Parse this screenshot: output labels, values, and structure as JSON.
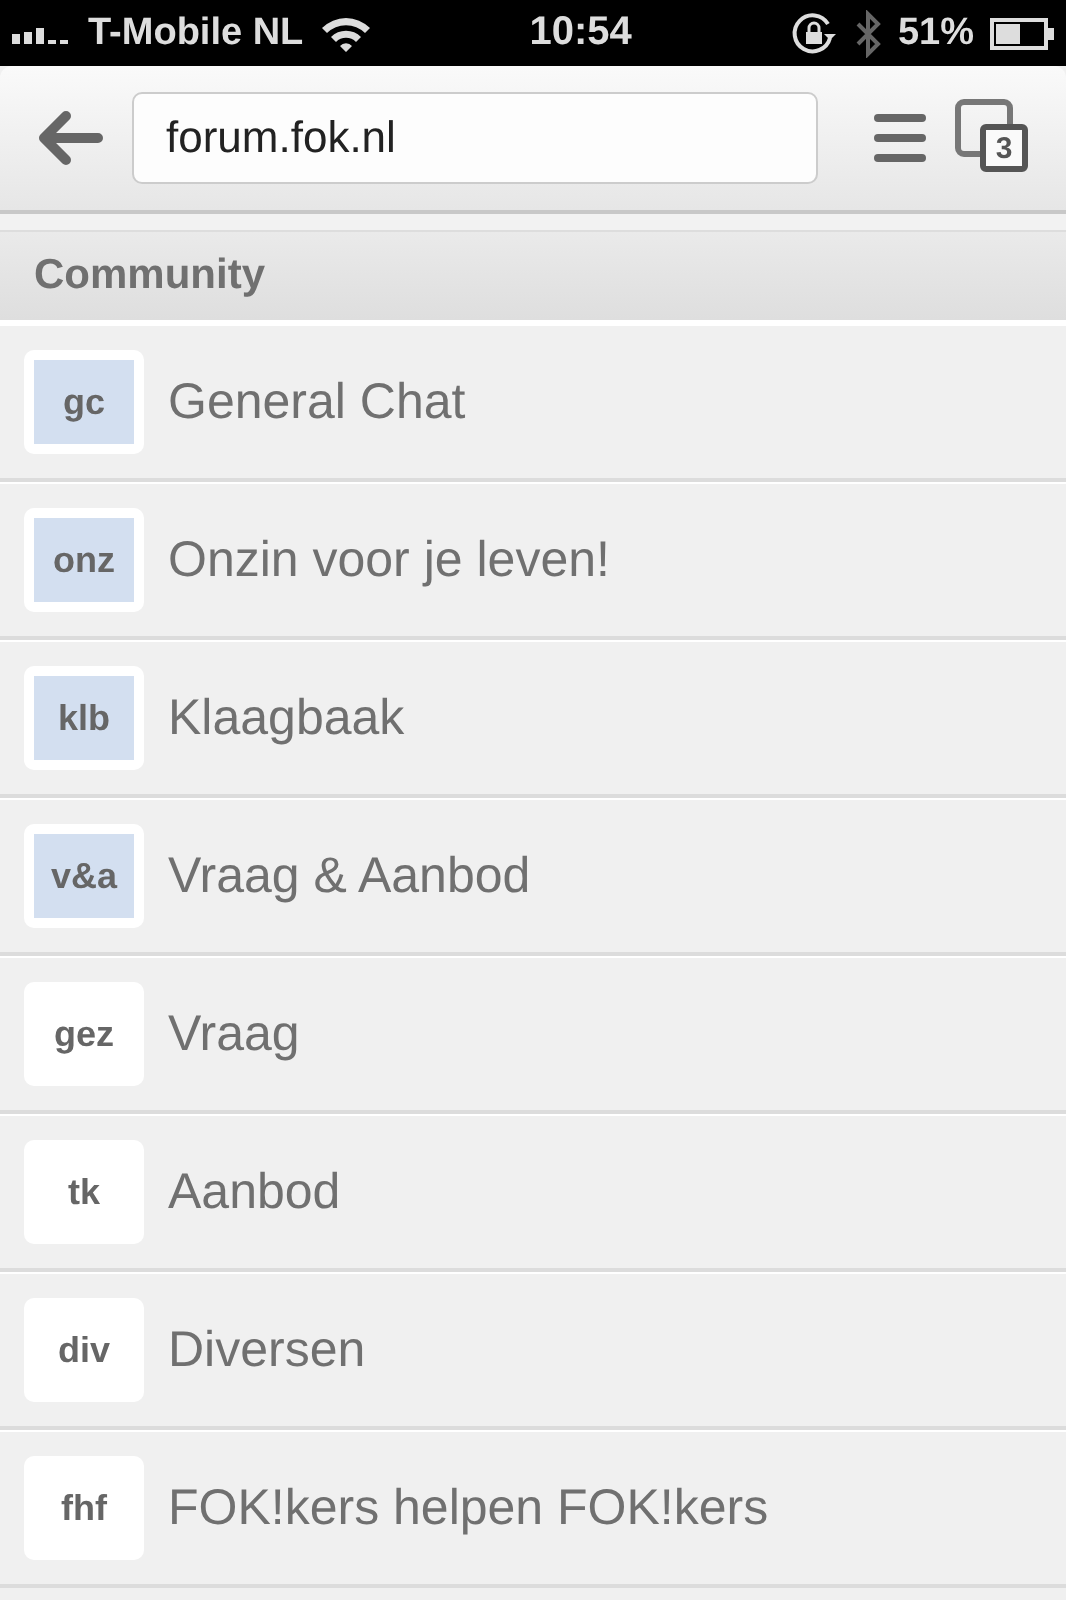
{
  "status_bar": {
    "carrier": "T-Mobile NL",
    "time": "10:54",
    "battery": "51%"
  },
  "toolbar": {
    "url": "forum.fok.nl",
    "tab_count": "3"
  },
  "section": {
    "title": "Community"
  },
  "forums": [
    {
      "abbr": "gc",
      "name": "General Chat",
      "color": "#d3dff0"
    },
    {
      "abbr": "onz",
      "name": "Onzin voor je leven!",
      "color": "#d3dff0"
    },
    {
      "abbr": "klb",
      "name": "Klaagbaak",
      "color": "#d3dff0"
    },
    {
      "abbr": "v&a",
      "name": "Vraag & Aanbod",
      "color": "#d3dff0"
    },
    {
      "abbr": "gez",
      "name": "Vraag",
      "color": "#ffffff"
    },
    {
      "abbr": "tk",
      "name": "Aanbod",
      "color": "#ffffff"
    },
    {
      "abbr": "div",
      "name": "Diversen",
      "color": "#ffffff"
    },
    {
      "abbr": "fhf",
      "name": "FOK!kers helpen FOK!kers",
      "color": "#ffffff"
    }
  ]
}
